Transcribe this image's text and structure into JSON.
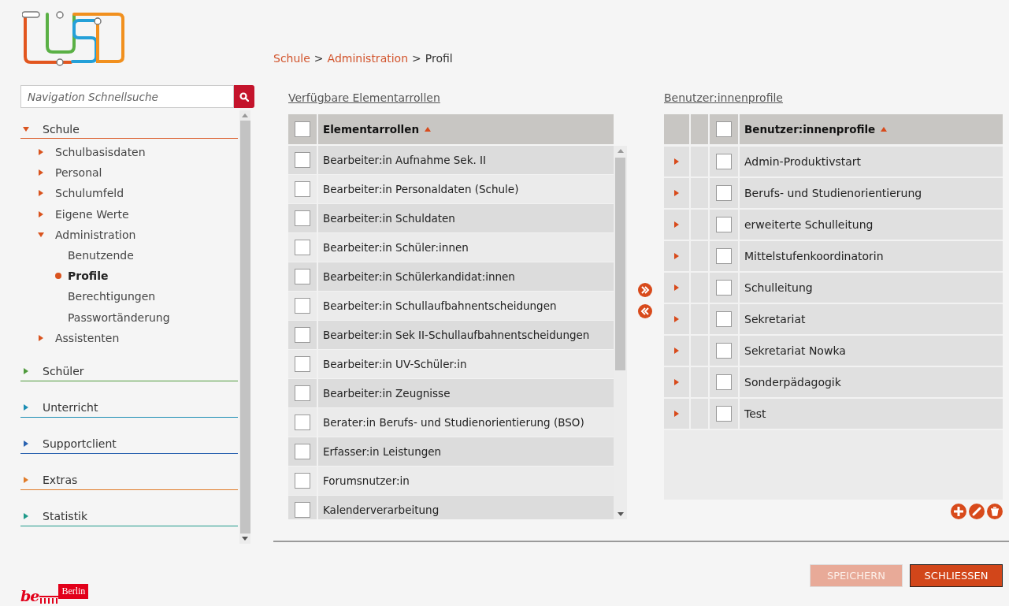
{
  "sidebar": {
    "search": {
      "placeholder": "Navigation Schnellsuche"
    },
    "nav": [
      {
        "label": "Schule",
        "expanded": true,
        "color": "#d9531e",
        "children": [
          {
            "label": "Schulbasisdaten",
            "expanded": false
          },
          {
            "label": "Personal",
            "expanded": false
          },
          {
            "label": "Schulumfeld",
            "expanded": false
          },
          {
            "label": "Eigene Werte",
            "expanded": false
          },
          {
            "label": "Administration",
            "expanded": true,
            "children": [
              {
                "label": "Benutzende",
                "selected": false
              },
              {
                "label": "Profile",
                "selected": true
              },
              {
                "label": "Berechtigungen",
                "selected": false
              },
              {
                "label": "Passwortänderung",
                "selected": false
              }
            ]
          },
          {
            "label": "Assistenten",
            "expanded": false
          }
        ]
      },
      {
        "label": "Schüler",
        "expanded": false,
        "color": "#4f9a3c"
      },
      {
        "label": "Unterricht",
        "expanded": false,
        "color": "#1b8db3"
      },
      {
        "label": "Supportclient",
        "expanded": false,
        "color": "#2a62b0"
      },
      {
        "label": "Extras",
        "expanded": false,
        "color": "#e07b28"
      },
      {
        "label": "Statistik",
        "expanded": false,
        "color": "#1f9a8a"
      }
    ],
    "footer_logo": {
      "mark": "be",
      "label": "Berlin"
    }
  },
  "breadcrumb": {
    "separator": ">",
    "items": [
      {
        "label": "Schule",
        "link": true
      },
      {
        "label": "Administration",
        "link": true
      },
      {
        "label": "Profil",
        "link": false
      }
    ]
  },
  "available": {
    "title": "Verfügbare Elementarrollen",
    "column": "Elementarrollen",
    "all_checked": false,
    "rows": [
      {
        "label": "Bearbeiter:in Aufnahme Sek. II",
        "checked": false
      },
      {
        "label": "Bearbeiter:in Personaldaten (Schule)",
        "checked": false
      },
      {
        "label": "Bearbeiter:in Schuldaten",
        "checked": false
      },
      {
        "label": "Bearbeiter:in Schüler:innen",
        "checked": false
      },
      {
        "label": "Bearbeiter:in Schülerkandidat:innen",
        "checked": false
      },
      {
        "label": "Bearbeiter:in Schullaufbahnentscheidungen",
        "checked": false
      },
      {
        "label": "Bearbeiter:in Sek II-Schullaufbahnentscheidungen",
        "checked": false
      },
      {
        "label": "Bearbeiter:in UV-Schüler:in",
        "checked": false
      },
      {
        "label": "Bearbeiter:in Zeugnisse",
        "checked": false
      },
      {
        "label": "Berater:in Berufs- und Studienorientierung (BSO)",
        "checked": false
      },
      {
        "label": "Erfasser:in Leistungen",
        "checked": false
      },
      {
        "label": "Forumsnutzer:in",
        "checked": false
      },
      {
        "label": "Kalenderverarbeitung",
        "checked": false
      }
    ]
  },
  "profiles": {
    "title": "Benutzer:innenprofile",
    "column": "Benutzer:innenprofile",
    "all_checked": false,
    "rows": [
      {
        "label": "Admin-Produktivstart",
        "checked": false,
        "expanded": false
      },
      {
        "label": "Berufs- und Studienorientierung",
        "checked": false,
        "expanded": false
      },
      {
        "label": "erweiterte Schulleitung",
        "checked": false,
        "expanded": false
      },
      {
        "label": "Mittelstufenkoordinatorin",
        "checked": false,
        "expanded": false
      },
      {
        "label": "Schulleitung",
        "checked": false,
        "expanded": false
      },
      {
        "label": "Sekretariat",
        "checked": false,
        "expanded": false
      },
      {
        "label": "Sekretariat Nowka",
        "checked": false,
        "expanded": false
      },
      {
        "label": "Sonderpädagogik",
        "checked": false,
        "expanded": false
      },
      {
        "label": "Test",
        "checked": false,
        "expanded": false
      }
    ]
  },
  "buttons": [
    {
      "label": "SPEICHERN",
      "disabled": true
    },
    {
      "label": "SCHLIESSEN",
      "disabled": false
    }
  ]
}
